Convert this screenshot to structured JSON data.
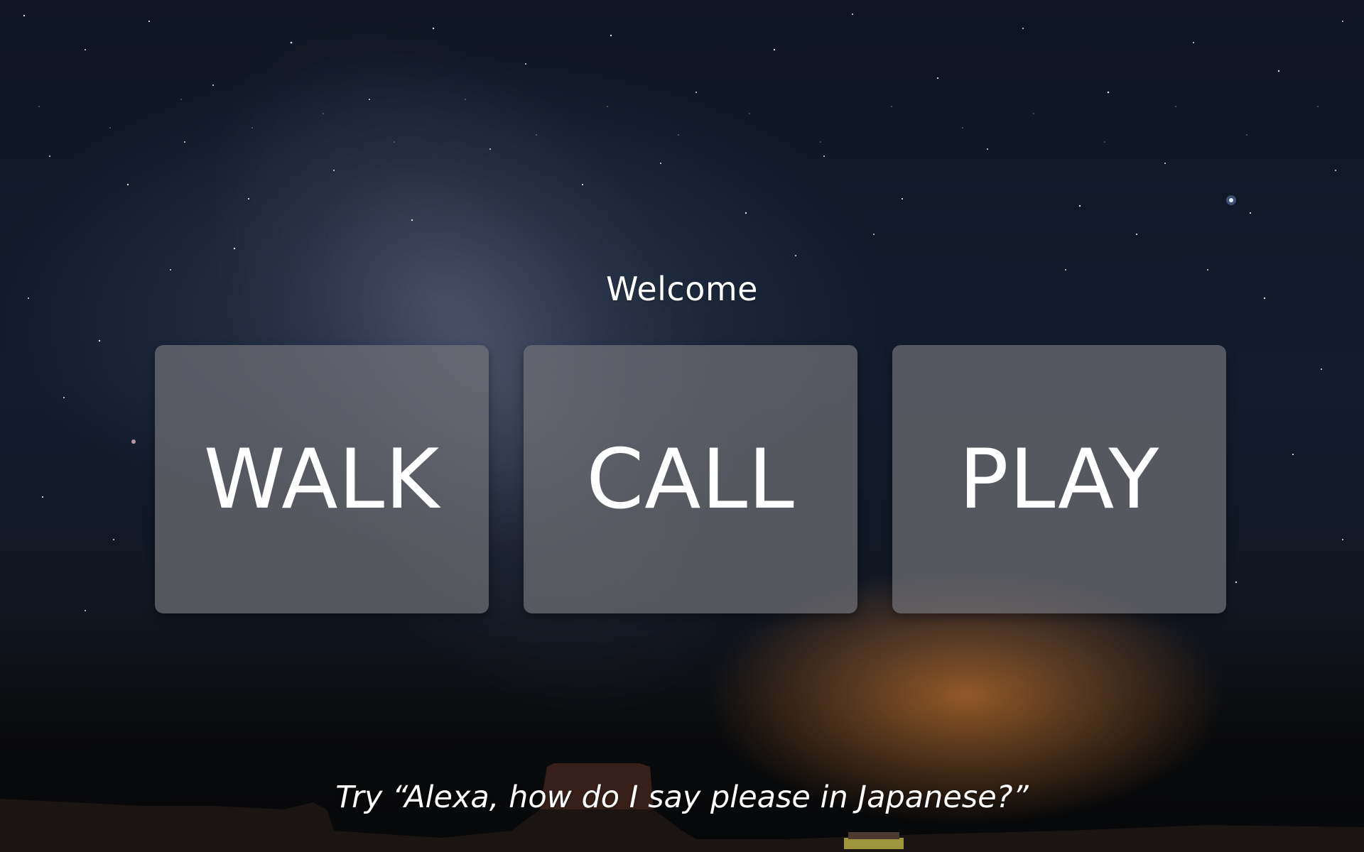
{
  "welcome_text": "Welcome",
  "tiles": [
    {
      "label": "WALK"
    },
    {
      "label": "CALL"
    },
    {
      "label": "PLAY"
    }
  ],
  "hint_text": "Try “Alexa, how do I say please in Japanese?”"
}
